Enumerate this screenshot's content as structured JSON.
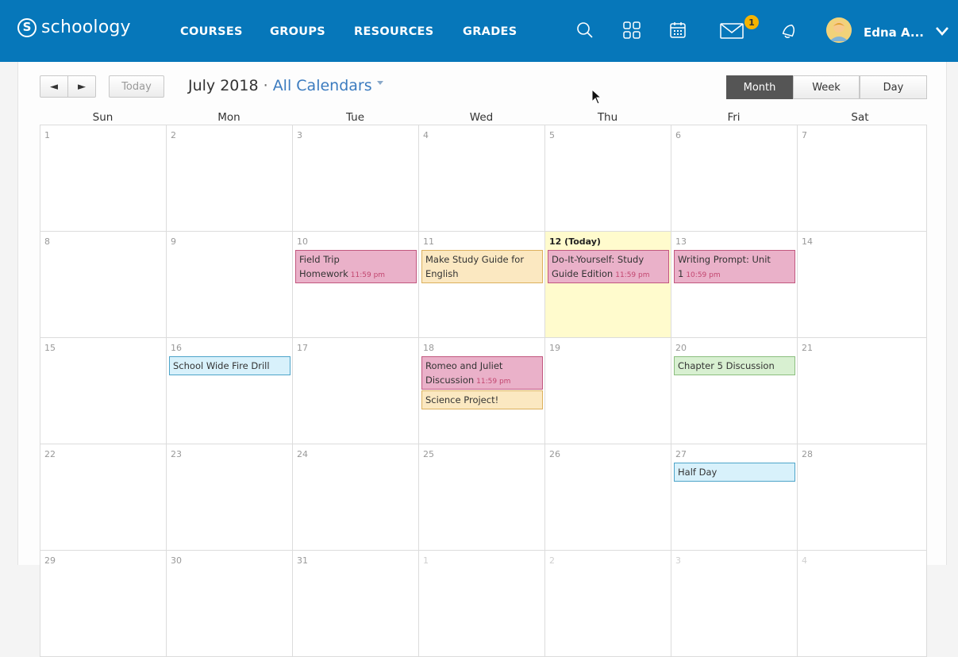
{
  "nav": {
    "logo_text": "schoology",
    "logo_mark": "S",
    "links": [
      "COURSES",
      "GROUPS",
      "RESOURCES",
      "GRADES"
    ],
    "icons": [
      "search-icon",
      "apps-grid-icon",
      "calendar-icon",
      "mail-icon",
      "bell-icon"
    ],
    "mail_badge": "1",
    "user_name": "Edna A...",
    "brand_color": "#0677ba"
  },
  "toolbar": {
    "prev_label": "◄",
    "next_label": "►",
    "today_label": "Today",
    "month_year": "July 2018",
    "separator": " · ",
    "calendar_select": "All Calendars",
    "views": [
      "Month",
      "Week",
      "Day"
    ],
    "active_view": "Month"
  },
  "weekdays": [
    "Sun",
    "Mon",
    "Tue",
    "Wed",
    "Thu",
    "Fri",
    "Sat"
  ],
  "weeks": [
    [
      "1",
      "2",
      "3",
      "4",
      "5",
      "6",
      "7"
    ],
    [
      "8",
      "9",
      "10",
      "11",
      "12 (Today)",
      "13",
      "14"
    ],
    [
      "15",
      "16",
      "17",
      "18",
      "19",
      "20",
      "21"
    ],
    [
      "22",
      "23",
      "24",
      "25",
      "26",
      "27",
      "28"
    ],
    [
      "29",
      "30",
      "31",
      "1",
      "2",
      "3",
      "4"
    ]
  ],
  "events": {
    "field_trip": {
      "title": "Field Trip Homework",
      "time": "11:59 pm"
    },
    "study_guide": {
      "title": "Make Study Guide for English",
      "time": ""
    },
    "diy": {
      "title": "Do-It-Yourself: Study Guide Edition",
      "time": "11:59 pm"
    },
    "writing_prompt": {
      "title": "Writing Prompt: Unit 1",
      "time": "10:59 pm"
    },
    "fire_drill": {
      "title": "School Wide Fire Drill",
      "time": ""
    },
    "romeo": {
      "title": "Romeo and Juliet Discussion",
      "time": "11:59 pm"
    },
    "science": {
      "title": "Science Project!",
      "time": ""
    },
    "chapter5": {
      "title": "Chapter 5 Discussion",
      "time": ""
    },
    "half_day": {
      "title": "Half Day",
      "time": ""
    }
  }
}
